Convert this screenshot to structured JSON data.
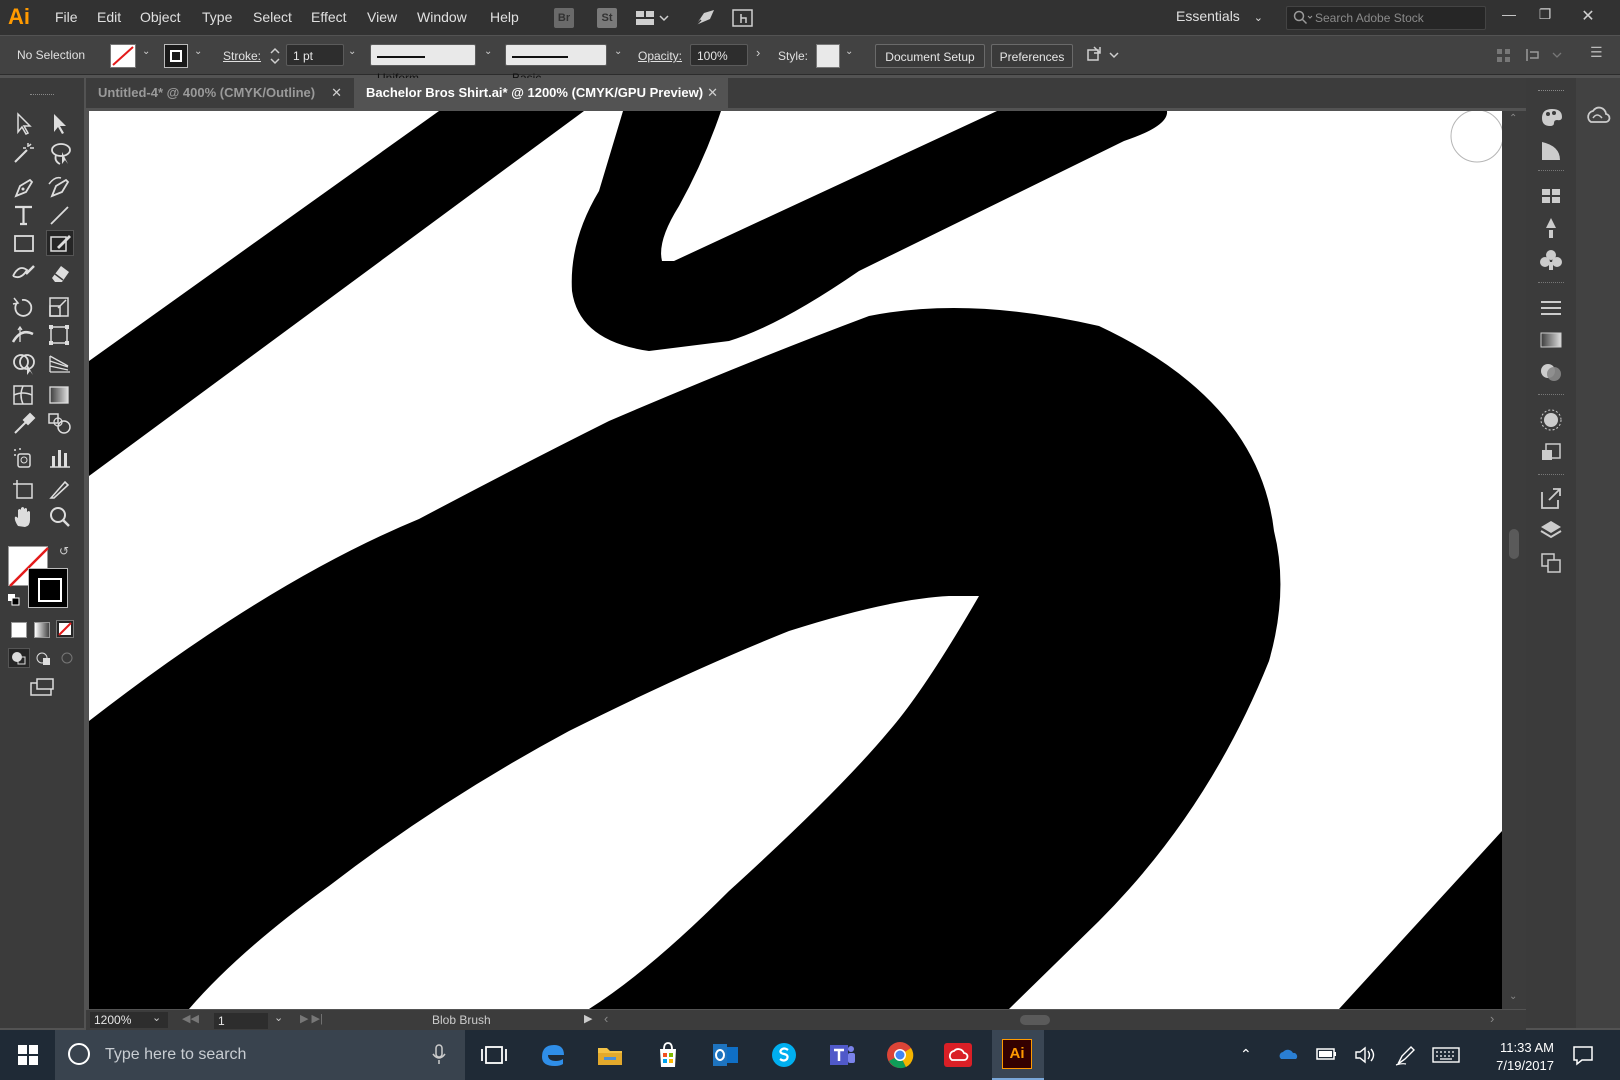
{
  "app": {
    "logo": "Ai",
    "menus": [
      "File",
      "Edit",
      "Object",
      "Type",
      "Select",
      "Effect",
      "View",
      "Window",
      "Help"
    ],
    "bridge": "Br",
    "stock": "St",
    "workspace": "Essentials",
    "search_stock_placeholder": "Search Adobe Stock"
  },
  "control": {
    "selection": "No Selection",
    "stroke_label": "Stroke:",
    "stroke_weight": "1 pt",
    "profile": "Uniform",
    "brush": "Basic",
    "opacity_label": "Opacity:",
    "opacity_value": "100%",
    "style_label": "Style:",
    "document_setup": "Document Setup",
    "preferences": "Preferences"
  },
  "tabs": [
    {
      "label": "Untitled-4* @ 400% (CMYK/Outline)",
      "active": false
    },
    {
      "label": "Bachelor Bros Shirt.ai* @ 1200% (CMYK/GPU Preview)",
      "active": true
    }
  ],
  "status": {
    "zoom": "1200%",
    "artboard": "1",
    "tool": "Blob Brush"
  },
  "taskbar": {
    "search_placeholder": "Type here to search",
    "time": "11:33 AM",
    "date": "7/19/2017"
  },
  "colors": {
    "accent": "#ff9a00",
    "canvas": "#ffffff",
    "ink": "#000000"
  }
}
